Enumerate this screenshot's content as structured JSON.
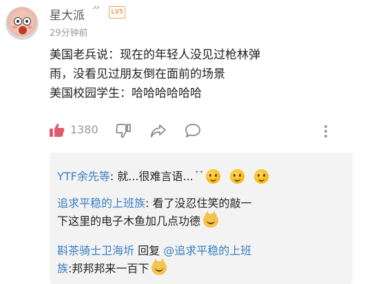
{
  "comment": {
    "username": "星大派",
    "user_mark": "\\'\\'",
    "level_badge": "LV5",
    "timestamp": "29分钟前",
    "lines": [
      "美国老兵说：现在的年轻人没见过枪林弹",
      "雨，没看见过朋友倒在面前的场景",
      "美国校园学生：哈哈哈哈哈哈"
    ],
    "likes": "1380"
  },
  "icons": {
    "like": "thumbs-up-icon",
    "dislike": "thumbs-down-icon",
    "share": "share-icon",
    "reply": "comment-icon",
    "more": "more-vertical-icon"
  },
  "replies": [
    {
      "name": "YTF余先等",
      "sep": ": ",
      "text": "就...很难言语...",
      "emojis": [
        "laugh-cry-emoji",
        "laugh-cry-emoji",
        "laugh-cry-emoji"
      ]
    },
    {
      "name": "追求平稳的上班族",
      "sep": ": ",
      "text_line1": "看了没忍住笑的敲一",
      "text_line2": "下这里的电子木鱼加几点功德",
      "emojis": [
        "cat-emoji"
      ]
    },
    {
      "name": "斟茶骑士卫海圻",
      "reply_word": " 回复 ",
      "mention": "@追求平稳的上班",
      "mention_line2": "族",
      "text": ":邦邦邦来一百下",
      "emojis": [
        "cat-emoji"
      ]
    }
  ],
  "colors": {
    "link": "#3a7fc1",
    "like_accent": "#e05a6d",
    "badge": "#e8a35a",
    "reply_bg": "#f3f3f3"
  }
}
